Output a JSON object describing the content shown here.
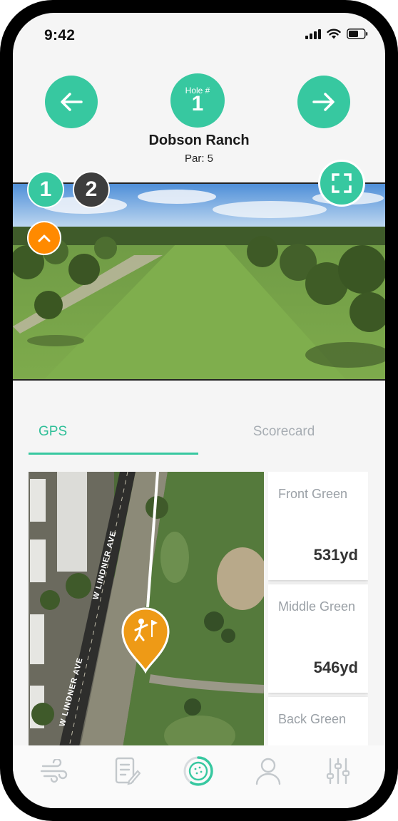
{
  "status": {
    "time": "9:42"
  },
  "header": {
    "hole_label": "Hole #",
    "hole_number": "1",
    "course_name": "Dobson Ranch",
    "par": "Par: 5"
  },
  "flyover": {
    "view_options": [
      "1",
      "2"
    ],
    "active_view": "1"
  },
  "tabs": [
    {
      "label": "GPS",
      "active": true
    },
    {
      "label": "Scorecard",
      "active": false
    }
  ],
  "map": {
    "street_labels": [
      "W LINDNER AVE",
      "W LINDNER AVE"
    ]
  },
  "distances": [
    {
      "label": "Front Green",
      "value": "531yd"
    },
    {
      "label": "Middle Green",
      "value": "546yd"
    },
    {
      "label": "Back Green",
      "value": ""
    }
  ],
  "bottom_nav": [
    "wind-icon",
    "scorecard-edit-icon",
    "golf-ball-icon",
    "profile-icon",
    "settings-sliders-icon"
  ],
  "colors": {
    "accent": "#37c8a0",
    "secondary_dark": "#3d3d3d",
    "orange": "#ff8a00"
  }
}
